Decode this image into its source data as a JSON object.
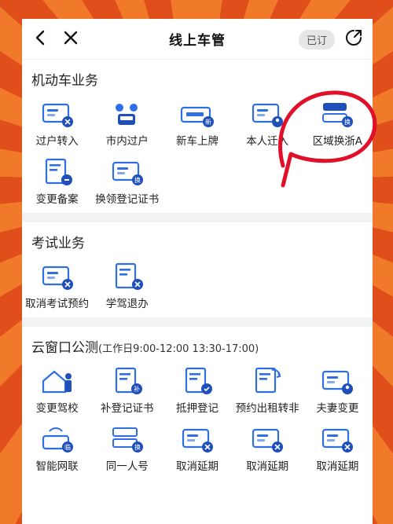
{
  "header": {
    "title": "线上车管",
    "subscribe_label": "已订"
  },
  "colors": {
    "accent": "#2f6fe4",
    "badge": "#1f4fb8",
    "background": "#e8571f",
    "annotation": "#e0102a"
  },
  "sections": [
    {
      "title": "机动车业务",
      "items": [
        {
          "label": "过户转入",
          "icon": "transfer-in-icon"
        },
        {
          "label": "市内过户",
          "icon": "city-transfer-icon"
        },
        {
          "label": "新车上牌",
          "icon": "new-plate-icon"
        },
        {
          "label": "本人迁入",
          "icon": "self-move-in-icon"
        },
        {
          "label": "区域换浙A",
          "icon": "region-switch-icon"
        },
        {
          "label": "变更备案",
          "icon": "change-record-icon"
        },
        {
          "label": "换领登记证书",
          "icon": "renew-certificate-icon"
        }
      ]
    },
    {
      "title": "考试业务",
      "items": [
        {
          "label": "取消考试预约",
          "icon": "cancel-exam-icon"
        },
        {
          "label": "学驾退办",
          "icon": "learner-withdraw-icon"
        }
      ]
    },
    {
      "title": "云窗口公测",
      "note": "(工作日9:00-12:00 13:30-17:00)",
      "items": [
        {
          "label": "变更驾校",
          "icon": "change-school-icon"
        },
        {
          "label": "补登记证书",
          "icon": "reissue-certificate-icon"
        },
        {
          "label": "抵押登记",
          "icon": "mortgage-icon"
        },
        {
          "label": "预约出租转非",
          "icon": "taxi-convert-icon"
        },
        {
          "label": "夫妻变更",
          "icon": "spouse-change-icon"
        },
        {
          "label": "智能网联",
          "icon": "smart-network-icon"
        },
        {
          "label": "同一人号",
          "icon": "same-person-plate-icon"
        },
        {
          "label": "取消延期",
          "icon": "cancel-extension-icon"
        },
        {
          "label": "取消延期",
          "icon": "cancel-extension-icon"
        },
        {
          "label": "取消延期",
          "icon": "cancel-extension-icon"
        }
      ]
    }
  ]
}
